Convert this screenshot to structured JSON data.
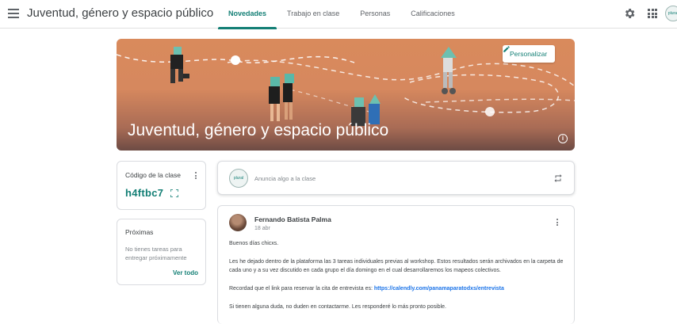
{
  "header": {
    "class_title": "Juventud, género y espacio público",
    "tabs": [
      {
        "label": "Novedades",
        "active": true
      },
      {
        "label": "Trabajo en clase",
        "active": false
      },
      {
        "label": "Personas",
        "active": false
      },
      {
        "label": "Calificaciones",
        "active": false
      }
    ],
    "avatar_text": "plural"
  },
  "banner": {
    "title": "Juventud, género y espacio público",
    "customize_label": "Personalizar",
    "info_glyph": "i"
  },
  "class_code": {
    "label": "Código de la clase",
    "value": "h4ftbc7"
  },
  "upcoming": {
    "title": "Próximas",
    "empty_text": "No tienes tareas para entregar próximamente",
    "view_all": "Ver todo"
  },
  "announce": {
    "avatar_text": "plural",
    "placeholder": "Anuncia algo a la clase"
  },
  "post": {
    "author": "Fernando Batista Palma",
    "date": "18 abr",
    "greeting": "Buenos días chicxs.",
    "paragraph1": "Les he dejado dentro de la plataforma las 3 tareas individuales previas al workshop. Estos resultados serán archivados en la carpeta de cada uno y a su vez discutido en cada grupo el día domingo en el cual desarrollaremos los mapeos colectivos.",
    "link_intro": "Recordad que el link para reservar la cita de entrevista es: ",
    "link": "https://calendly.com/panamaparatodxs/entrevista",
    "closing": "Si tienen alguna duda, no duden en contactarme. Les responderé lo más pronto posible."
  },
  "colors": {
    "accent": "#137f75",
    "link": "#1a73e8",
    "banner_top": "#d98a5c",
    "banner_bottom": "#6d4b44"
  },
  "icons": [
    "menu-icon",
    "gear-icon",
    "apps-grid-icon",
    "pencil-icon",
    "info-icon",
    "fullscreen-icon",
    "repost-icon",
    "more-vert-icon"
  ]
}
